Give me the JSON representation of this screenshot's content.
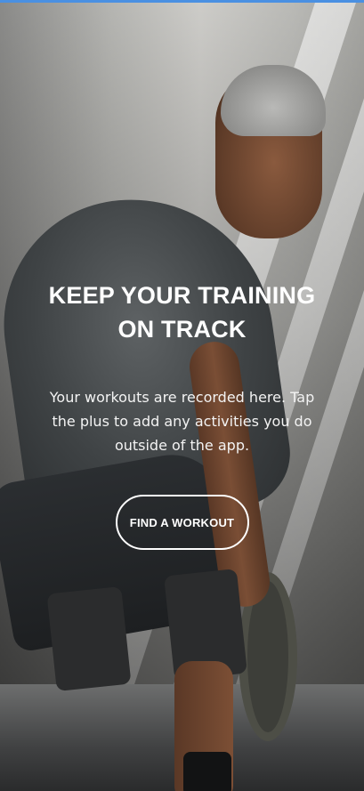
{
  "empty_state": {
    "headline": "KEEP YOUR TRAINING ON TRACK",
    "description": "Your workouts are recorded here. Tap the plus to add any activities you do outside of the app.",
    "cta_label": "FIND A WORKOUT"
  },
  "colors": {
    "text": "#ffffff",
    "button_border": "#ffffff",
    "top_accent": "#4a90e2"
  }
}
